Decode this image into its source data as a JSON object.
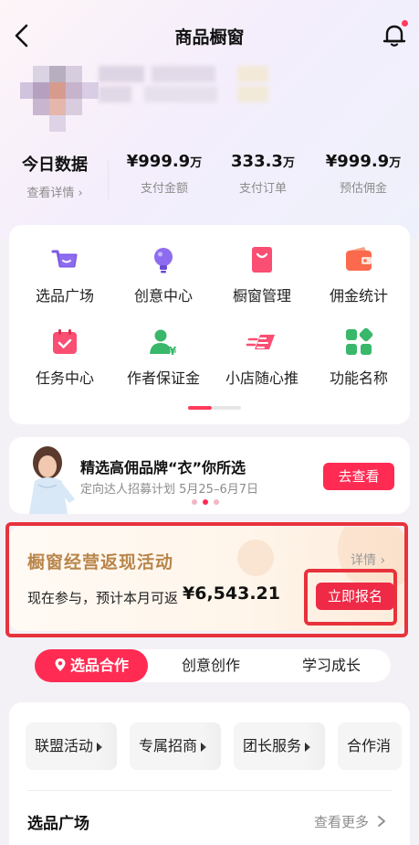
{
  "header": {
    "title": "商品橱窗"
  },
  "colors": {
    "accent": "#ff2b53",
    "gold": "#b9864c",
    "highlight_box": "#e8323c"
  },
  "stats": {
    "today": {
      "title": "今日数据",
      "link": "查看详情"
    },
    "items": [
      {
        "value": "¥999.9",
        "unit": "万",
        "label": "支付金额"
      },
      {
        "value": "333.3",
        "unit": "万",
        "label": "支付订单"
      },
      {
        "value": "¥999.9",
        "unit": "万",
        "label": "预估佣金"
      }
    ]
  },
  "grid": [
    {
      "label": "选品广场",
      "icon": "cart-icon"
    },
    {
      "label": "创意中心",
      "icon": "lightbulb-icon"
    },
    {
      "label": "橱窗管理",
      "icon": "shopping-bag-icon"
    },
    {
      "label": "佣金统计",
      "icon": "wallet-icon"
    },
    {
      "label": "任务中心",
      "icon": "calendar-check-icon"
    },
    {
      "label": "作者保证金",
      "icon": "user-yuan-icon"
    },
    {
      "label": "小店随心推",
      "icon": "rocket-icon"
    },
    {
      "label": "功能名称",
      "icon": "apps-icon"
    }
  ],
  "banner": {
    "title": "精选高佣品牌“衣”你所选",
    "subtitle": "定向达人招募计划 5月25–6月7日",
    "button": "去查看"
  },
  "activity": {
    "title": "橱窗经营返现活动",
    "detail": "详情",
    "text": "现在参与，预计本月可返",
    "amount": "¥6,543.21",
    "button": "立即报名"
  },
  "tabs": [
    {
      "label": "选品合作",
      "active": true,
      "icon": "location-pin-icon"
    },
    {
      "label": "创意创作",
      "active": false
    },
    {
      "label": "学习成长",
      "active": false
    }
  ],
  "chips": [
    "联盟活动",
    "专属招商",
    "团长服务",
    "合作消"
  ],
  "section": {
    "title": "选品广场",
    "more": "查看更多"
  }
}
